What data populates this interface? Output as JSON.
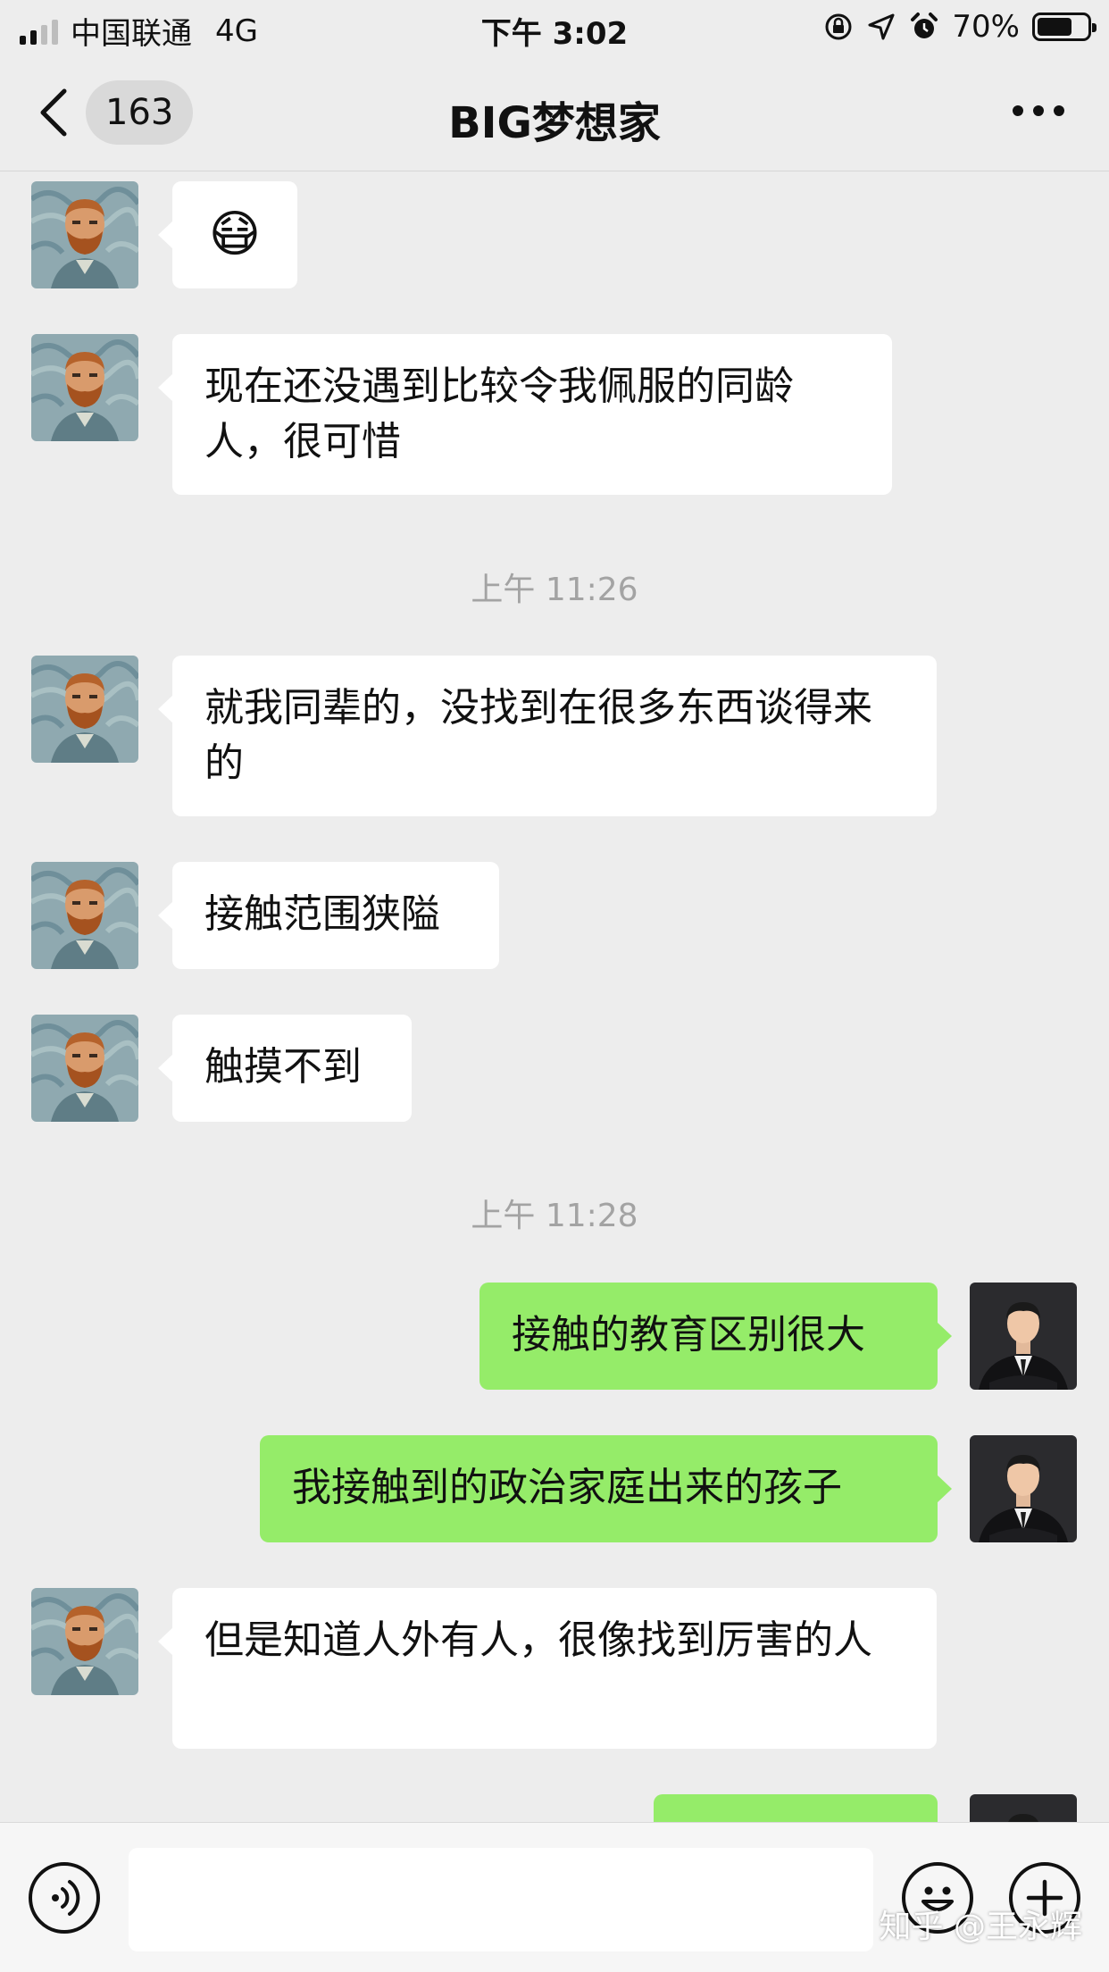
{
  "status_bar": {
    "carrier": "中国联通",
    "network": "4G",
    "time": "下午 3:02",
    "battery": "70%",
    "battery_level": 0.7
  },
  "nav": {
    "unread_count": "163",
    "title": "BIG梦想家"
  },
  "messages": [
    {
      "side": "left",
      "text": "😷"
    },
    {
      "side": "left",
      "text": "现在还没遇到比较令我佩服的同龄人，很可惜"
    },
    {
      "timestamp": "上午 11:26"
    },
    {
      "side": "left",
      "text": "就我同辈的，没找到在很多东西谈得来的"
    },
    {
      "side": "left",
      "text": "接触范围狭隘"
    },
    {
      "side": "left",
      "text": "触摸不到"
    },
    {
      "timestamp": "上午 11:28"
    },
    {
      "side": "right",
      "text": "接触的教育区别很大"
    },
    {
      "side": "right",
      "text": "我接触到的政治家庭出来的孩子"
    },
    {
      "side": "left",
      "text": "但是知道人外有人，很像找到厉害的人"
    },
    {
      "side": "right",
      "text": ""
    }
  ],
  "watermark": "知乎 @王永辉",
  "colors": {
    "background": "#ededed",
    "self_bubble": "#95ec69",
    "other_bubble": "#ffffff",
    "timestamp": "#a3a3a3"
  },
  "icons": {
    "back": "chevron-left-icon",
    "more": "ellipsis-icon",
    "voice": "voice-icon",
    "emoji": "emoji-icon",
    "plus": "plus-icon"
  }
}
